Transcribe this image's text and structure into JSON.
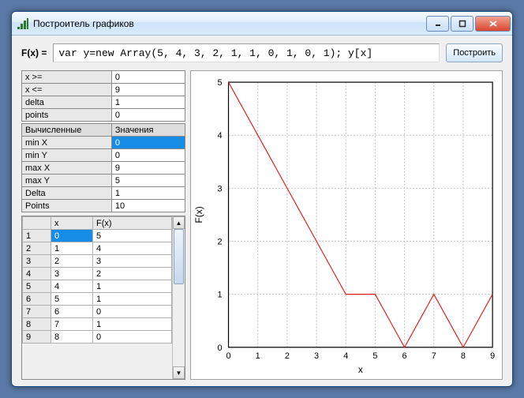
{
  "window": {
    "title": "Построитель графиков"
  },
  "formula": {
    "label": "F(x) =",
    "value": "var y=new Array(5, 4, 3, 2, 1, 1, 0, 1, 0, 1); y[x]"
  },
  "build_button": "Построить",
  "params": [
    {
      "name": "x >=",
      "value": "0"
    },
    {
      "name": "x <=",
      "value": "9"
    },
    {
      "name": "delta",
      "value": "1"
    },
    {
      "name": "points",
      "value": "0"
    }
  ],
  "computed_header": {
    "left": "Вычисленные",
    "right": "Значения"
  },
  "computed": [
    {
      "name": "min X",
      "value": "0",
      "selected": true
    },
    {
      "name": "min Y",
      "value": "0"
    },
    {
      "name": "max X",
      "value": "9"
    },
    {
      "name": "max Y",
      "value": "5"
    },
    {
      "name": "Delta",
      "value": "1"
    },
    {
      "name": "Points",
      "value": "10"
    }
  ],
  "datatable": {
    "headers": {
      "idx": "",
      "x": "x",
      "fx": "F(x)"
    },
    "rows": [
      {
        "idx": "1",
        "x": "0",
        "fx": "5",
        "selected": true
      },
      {
        "idx": "2",
        "x": "1",
        "fx": "4"
      },
      {
        "idx": "3",
        "x": "2",
        "fx": "3"
      },
      {
        "idx": "4",
        "x": "3",
        "fx": "2"
      },
      {
        "idx": "5",
        "x": "4",
        "fx": "1"
      },
      {
        "idx": "6",
        "x": "5",
        "fx": "1"
      },
      {
        "idx": "7",
        "x": "6",
        "fx": "0"
      },
      {
        "idx": "8",
        "x": "7",
        "fx": "1"
      },
      {
        "idx": "9",
        "x": "8",
        "fx": "0"
      }
    ]
  },
  "chart_data": {
    "type": "line",
    "xlabel": "x",
    "ylabel": "F(x)",
    "xlim": [
      0,
      9
    ],
    "ylim": [
      0,
      5
    ],
    "xticks": [
      0,
      1,
      2,
      3,
      4,
      5,
      6,
      7,
      8,
      9
    ],
    "yticks": [
      0,
      1,
      2,
      3,
      4,
      5
    ],
    "x": [
      0,
      1,
      2,
      3,
      4,
      5,
      6,
      7,
      8,
      9
    ],
    "y": [
      5,
      4,
      3,
      2,
      1,
      1,
      0,
      1,
      0,
      1
    ]
  }
}
